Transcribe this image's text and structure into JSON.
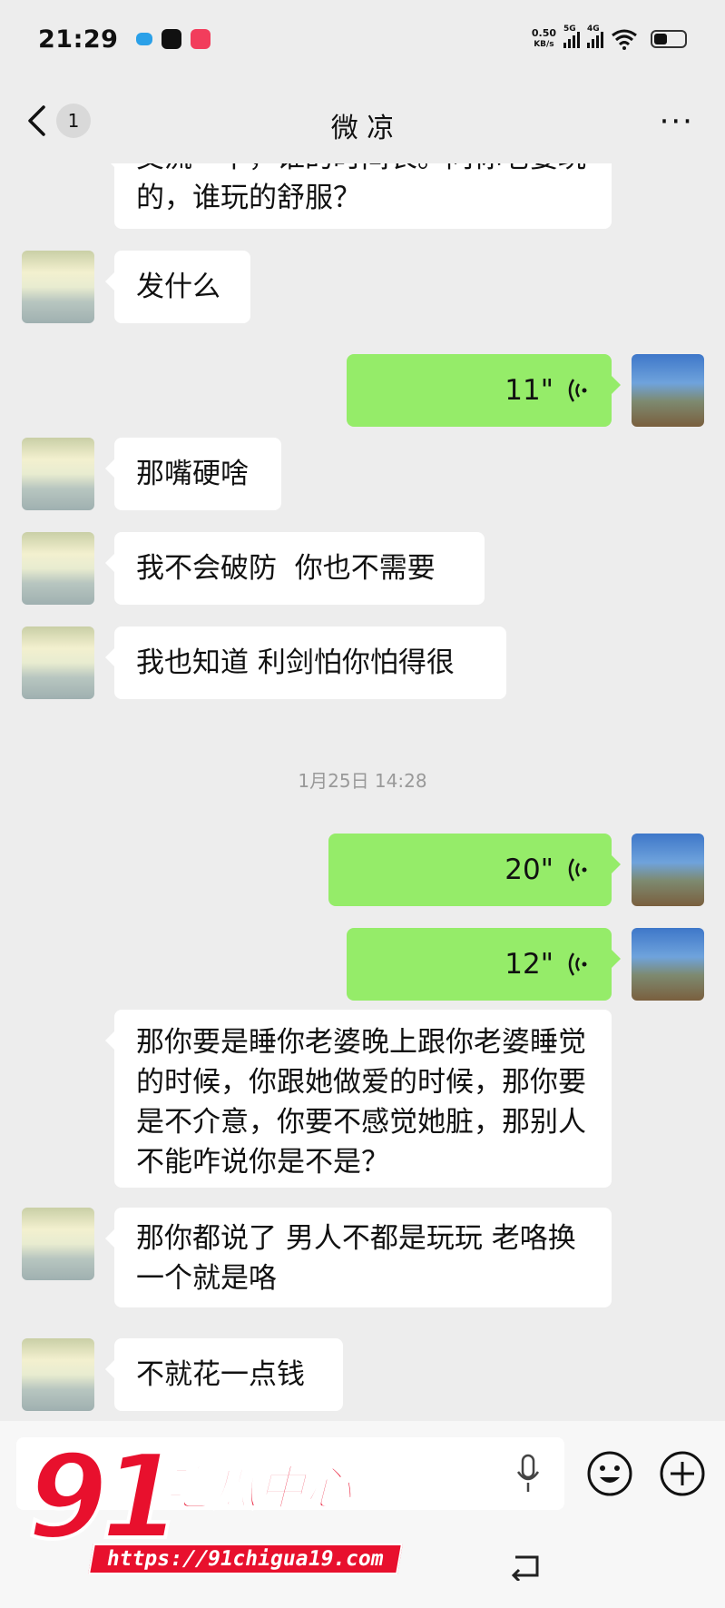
{
  "status_bar": {
    "time": "21:29",
    "net_speed_value": "0.50",
    "net_speed_unit": "KB/s",
    "sim1": "5G",
    "sim2": "4G"
  },
  "header": {
    "unread_count": "1",
    "title": "微 凉",
    "more": "···"
  },
  "messages": [
    {
      "side": "in",
      "type": "text",
      "text": "交流一下，谁的时间长。问你老婆玩的，谁玩的舒服？"
    },
    {
      "side": "in",
      "type": "text",
      "text": "发什么"
    },
    {
      "side": "out",
      "type": "voice",
      "duration": "11\""
    },
    {
      "side": "in",
      "type": "text",
      "text": "那嘴硬啥"
    },
    {
      "side": "in",
      "type": "text",
      "text": "我不会破防  你也不需要"
    },
    {
      "side": "in",
      "type": "text",
      "text": "我也知道 利剑怕你怕得很"
    },
    {
      "type": "timestamp",
      "text": "1月25日 14:28"
    },
    {
      "side": "out",
      "type": "voice",
      "duration": "20\""
    },
    {
      "side": "out",
      "type": "voice",
      "duration": "12\""
    },
    {
      "side": "in",
      "type": "text",
      "text": "那你要是睡你老婆晚上跟你老婆睡觉的时候，你跟她做爱的时候，那你要是不介意，你要不感觉她脏，那别人不能咋说你是不是？"
    },
    {
      "side": "in",
      "type": "text",
      "text": "那你都说了  男人不都是玩玩  老咯换一个就是咯"
    },
    {
      "side": "in",
      "type": "text",
      "text": "不就花一点钱"
    }
  ],
  "watermark": {
    "number": "91",
    "name": "吃瓜中心",
    "url": "https://91chigua19.com"
  },
  "colors": {
    "chat_bg": "#ededed",
    "bubble_in": "#ffffff",
    "bubble_out": "#95ec69",
    "watermark_red": "#e8102d"
  },
  "icons": [
    "back-chevron-icon",
    "more-icon",
    "voice-wave-icon",
    "voice-toggle-icon",
    "mic-icon",
    "emoji-icon",
    "plus-icon",
    "system-back-icon"
  ]
}
